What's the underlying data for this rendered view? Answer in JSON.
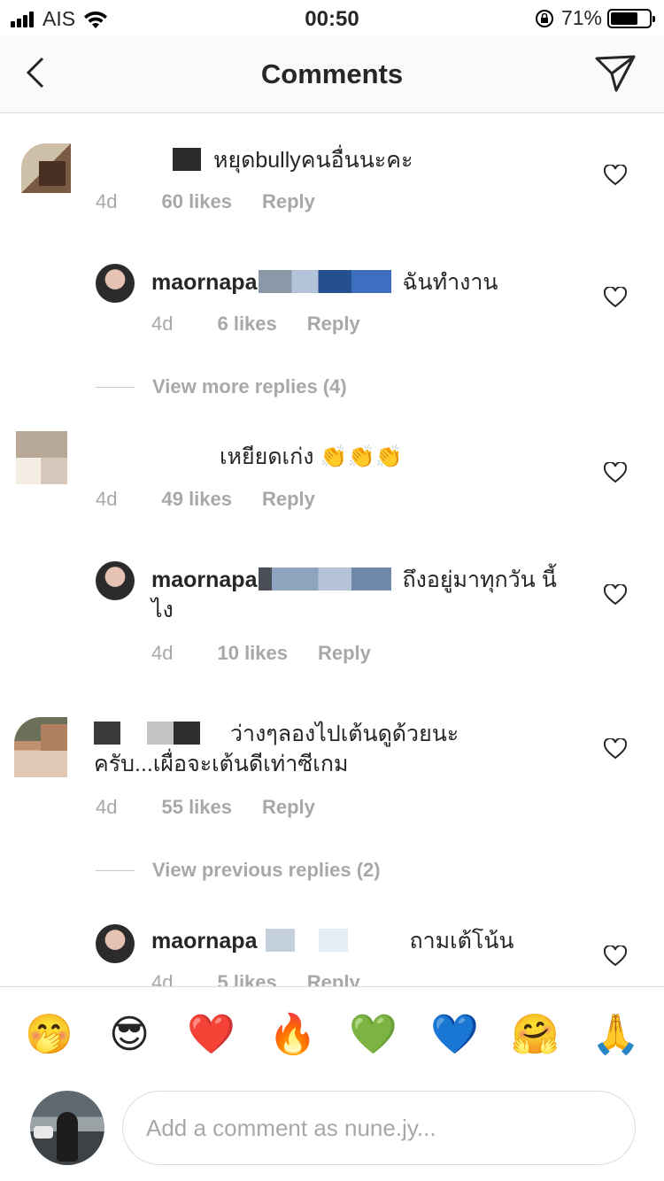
{
  "status_bar": {
    "carrier": "AIS",
    "time": "00:50",
    "battery_pct": "71%",
    "battery_level": 0.71
  },
  "nav": {
    "title": "Comments",
    "back_icon": "chevron-left-icon",
    "send_icon": "paper-plane-icon"
  },
  "comments": [
    {
      "username": "",
      "text": "หยุดbullyคนอื่นนะคะ",
      "time": "4d",
      "likes": "60 likes",
      "reply_label": "Reply"
    },
    {
      "username": "maornapa",
      "text": "ฉันทำงาน",
      "time": "4d",
      "likes": "6 likes",
      "reply_label": "Reply",
      "is_reply": true
    },
    {
      "view_more": "View more replies (4)"
    },
    {
      "username": "",
      "text": "เหยียดเก่ง 👏👏👏",
      "time": "4d",
      "likes": "49 likes",
      "reply_label": "Reply"
    },
    {
      "username": "maornapa",
      "text": "ถึงอยู่มาทุกวัน นี้ไง",
      "time": "4d",
      "likes": "10 likes",
      "reply_label": "Reply",
      "is_reply": true
    },
    {
      "username": "",
      "text": "ว่างๆลองไปเต้นดูด้วยนะ ครับ...เผื่อจะเต้นดีเท่าซีเกม",
      "time": "4d",
      "likes": "55 likes",
      "reply_label": "Reply"
    },
    {
      "view_more": "View previous replies (2)"
    },
    {
      "username": "maornapa",
      "text": "ถามเต้โน้น",
      "time": "4d",
      "likes": "5 likes",
      "reply_label": "Reply",
      "is_reply": true
    }
  ],
  "emoji_bar": [
    "🤭",
    "😎",
    "❤️",
    "🔥",
    "💚",
    "💙",
    "🤗",
    "🙏"
  ],
  "composer": {
    "placeholder": "Add a comment as nune.jy..."
  },
  "colors": {
    "text": "#262626",
    "secondary": "#a8a8a8",
    "divider": "#dbdbdb"
  }
}
